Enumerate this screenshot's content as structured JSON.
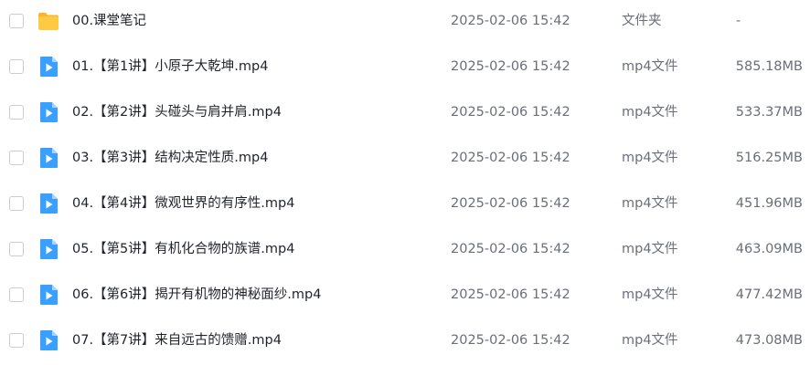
{
  "files": [
    {
      "name": "00.课堂笔记",
      "date": "2025-02-06 15:42",
      "type": "文件夹",
      "size": "-",
      "icon": "folder-icon"
    },
    {
      "name": "01.【第1讲】小原子大乾坤.mp4",
      "date": "2025-02-06 15:42",
      "type": "mp4文件",
      "size": "585.18MB",
      "icon": "video-file-icon"
    },
    {
      "name": "02.【第2讲】头碰头与肩并肩.mp4",
      "date": "2025-02-06 15:42",
      "type": "mp4文件",
      "size": "533.37MB",
      "icon": "video-file-icon"
    },
    {
      "name": "03.【第3讲】结构决定性质.mp4",
      "date": "2025-02-06 15:42",
      "type": "mp4文件",
      "size": "516.25MB",
      "icon": "video-file-icon"
    },
    {
      "name": "04.【第4讲】微观世界的有序性.mp4",
      "date": "2025-02-06 15:42",
      "type": "mp4文件",
      "size": "451.96MB",
      "icon": "video-file-icon"
    },
    {
      "name": "05.【第5讲】有机化合物的族谱.mp4",
      "date": "2025-02-06 15:42",
      "type": "mp4文件",
      "size": "463.09MB",
      "icon": "video-file-icon"
    },
    {
      "name": "06.【第6讲】揭开有机物的神秘面纱.mp4",
      "date": "2025-02-06 15:42",
      "type": "mp4文件",
      "size": "477.42MB",
      "icon": "video-file-icon"
    },
    {
      "name": "07.【第7讲】来自远古的馈赠.mp4",
      "date": "2025-02-06 15:42",
      "type": "mp4文件",
      "size": "473.08MB",
      "icon": "video-file-icon"
    }
  ],
  "colors": {
    "folder": "#ffc941",
    "folder_tab": "#ffb426",
    "video": "#3aa0ff",
    "video_fold": "#a9d4ff"
  }
}
